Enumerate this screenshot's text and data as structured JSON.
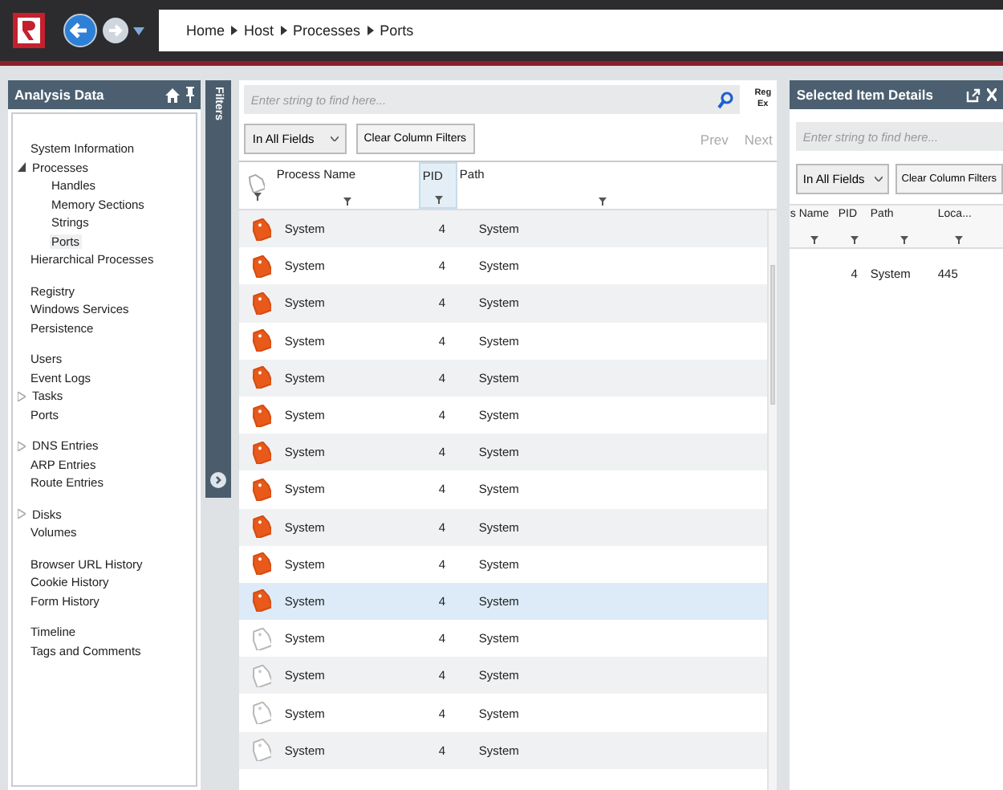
{
  "breadcrumb": [
    "Home",
    "Host",
    "Processes",
    "Ports"
  ],
  "sidebar": {
    "title": "Analysis Data",
    "groups": [
      [
        {
          "label": "System Information",
          "selected": false
        },
        {
          "label": "Processes",
          "expanded": true,
          "selected": false,
          "children": [
            {
              "label": "Handles",
              "selected": false
            },
            {
              "label": "Memory Sections",
              "selected": false
            },
            {
              "label": "Strings",
              "selected": false
            },
            {
              "label": "Ports",
              "selected": true
            }
          ]
        },
        {
          "label": "Hierarchical Processes",
          "selected": false
        }
      ],
      [
        {
          "label": "Registry",
          "selected": false
        },
        {
          "label": "Windows Services",
          "selected": false
        },
        {
          "label": "Persistence",
          "selected": false
        }
      ],
      [
        {
          "label": "Users",
          "selected": false
        },
        {
          "label": "Event Logs",
          "selected": false
        },
        {
          "label": "Tasks",
          "expanded": false,
          "selected": false
        },
        {
          "label": "Ports",
          "selected": false
        }
      ],
      [
        {
          "label": "DNS Entries",
          "expanded": false,
          "selected": false
        },
        {
          "label": "ARP Entries",
          "selected": false
        },
        {
          "label": "Route Entries",
          "selected": false
        }
      ],
      [
        {
          "label": "Disks",
          "expanded": false,
          "selected": false
        },
        {
          "label": "Volumes",
          "selected": false
        }
      ],
      [
        {
          "label": "Browser URL History",
          "selected": false
        },
        {
          "label": "Cookie History",
          "selected": false
        },
        {
          "label": "Form History",
          "selected": false
        }
      ],
      [
        {
          "label": "Timeline",
          "selected": false
        },
        {
          "label": "Tags and Comments",
          "selected": false
        }
      ]
    ]
  },
  "filters_tab": "Filters",
  "main": {
    "search": {
      "placeholder": "Enter string to find here..."
    },
    "regex": "Reg Ex",
    "scope": "In All Fields",
    "clear": "Clear Column Filters",
    "prev": "Prev",
    "next": "Next",
    "columns": [
      {
        "label": "Process Name",
        "sorted": false
      },
      {
        "label": "PID",
        "sorted": true
      },
      {
        "label": "Path",
        "sorted": false
      }
    ],
    "rows": [
      {
        "tagged": true,
        "selected": false,
        "cells": [
          "System",
          "4",
          "System"
        ]
      },
      {
        "tagged": true,
        "selected": false,
        "cells": [
          "System",
          "4",
          "System"
        ]
      },
      {
        "tagged": true,
        "selected": false,
        "cells": [
          "System",
          "4",
          "System"
        ]
      },
      {
        "tagged": true,
        "selected": false,
        "cells": [
          "System",
          "4",
          "System"
        ]
      },
      {
        "tagged": true,
        "selected": false,
        "cells": [
          "System",
          "4",
          "System"
        ]
      },
      {
        "tagged": true,
        "selected": false,
        "cells": [
          "System",
          "4",
          "System"
        ]
      },
      {
        "tagged": true,
        "selected": false,
        "cells": [
          "System",
          "4",
          "System"
        ]
      },
      {
        "tagged": true,
        "selected": false,
        "cells": [
          "System",
          "4",
          "System"
        ]
      },
      {
        "tagged": true,
        "selected": false,
        "cells": [
          "System",
          "4",
          "System"
        ]
      },
      {
        "tagged": true,
        "selected": false,
        "cells": [
          "System",
          "4",
          "System"
        ]
      },
      {
        "tagged": true,
        "selected": true,
        "cells": [
          "System",
          "4",
          "System"
        ]
      },
      {
        "tagged": false,
        "selected": false,
        "cells": [
          "System",
          "4",
          "System"
        ]
      },
      {
        "tagged": false,
        "selected": false,
        "cells": [
          "System",
          "4",
          "System"
        ]
      },
      {
        "tagged": false,
        "selected": false,
        "cells": [
          "System",
          "4",
          "System"
        ]
      },
      {
        "tagged": false,
        "selected": false,
        "cells": [
          "System",
          "4",
          "System"
        ]
      }
    ]
  },
  "details": {
    "title": "Selected Item Details",
    "search": {
      "placeholder": "Enter string to find here..."
    },
    "scope": "In All Fields",
    "clear": "Clear Column Filters",
    "columns": [
      "s Name",
      "PID",
      "Path",
      "Loca..."
    ],
    "rows": [
      [
        "",
        "4",
        "System",
        "445"
      ]
    ]
  }
}
